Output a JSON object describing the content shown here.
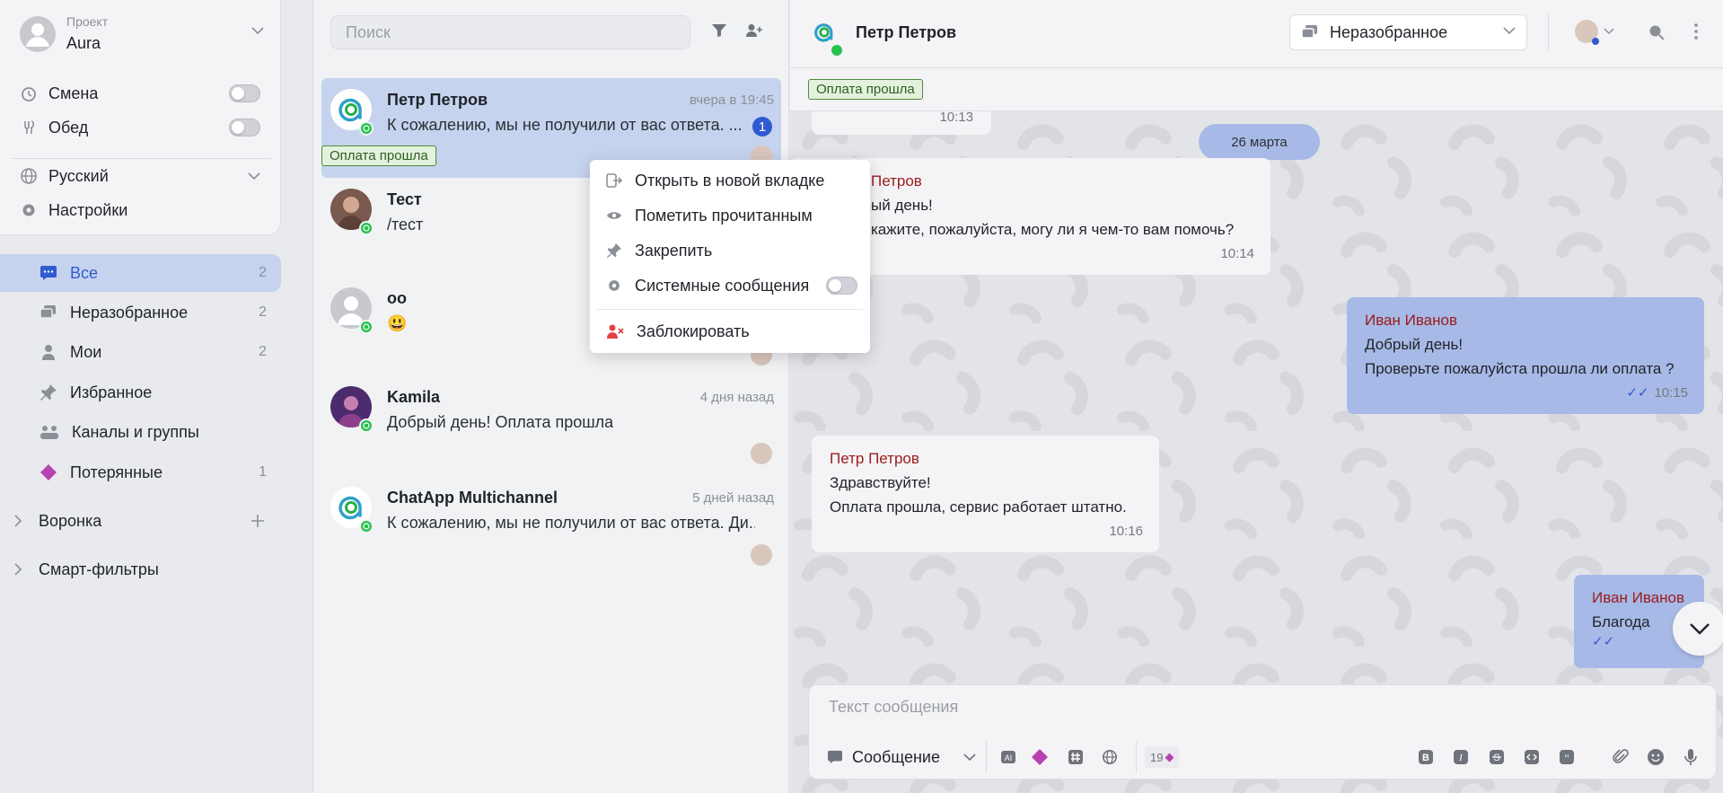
{
  "sidebar": {
    "project_label": "Проект",
    "project_name": "Aura",
    "shift_label": "Смена",
    "lunch_label": "Обед",
    "language": "Русский",
    "settings_label": "Настройки",
    "nav": [
      {
        "label": "Все",
        "count": "2",
        "icon": "chat-bubble-icon",
        "active": true
      },
      {
        "label": "Неразобранное",
        "count": "2",
        "icon": "inbox-stack-icon"
      },
      {
        "label": "Мои",
        "count": "2",
        "icon": "user-icon"
      },
      {
        "label": "Избранное",
        "count": "",
        "icon": "pin-icon"
      },
      {
        "label": "Каналы и группы",
        "count": "",
        "icon": "group-icon"
      },
      {
        "label": "Потерянные",
        "count": "1",
        "icon": "diamond-icon"
      }
    ],
    "groups": [
      {
        "label": "Воронка"
      },
      {
        "label": "Смарт-фильтры"
      }
    ]
  },
  "list": {
    "search_placeholder": "Поиск",
    "chats": [
      {
        "name": "Петр Петров",
        "time": "вчера в 19:45",
        "message": "К сожалению, мы не получили от вас ответа. ...",
        "unread": "1",
        "tag": "Оплата прошла"
      },
      {
        "name": "Тест",
        "time": "",
        "message": "/тест"
      },
      {
        "name": "оо",
        "time": "",
        "message": "😃"
      },
      {
        "name": "Kamila",
        "time": "4 дня назад",
        "message": "Добрый день! Оплата прошла"
      },
      {
        "name": "ChatApp Multichannel",
        "time": "5 дней назад",
        "message": "К сожалению, мы не получили от вас ответа. Ди..."
      }
    ]
  },
  "menu": {
    "open_new_tab": "Открыть в новой вкладке",
    "mark_read": "Пометить прочитанным",
    "pin": "Закрепить",
    "system_messages": "Системные сообщения",
    "block": "Заблокировать"
  },
  "conversation": {
    "contact_name": "Петр Петров",
    "status_dropdown": "Неразобранное",
    "tag": "Оплата прошла",
    "date_divider": "26 марта",
    "prev_time": "10:13",
    "messages": [
      {
        "from": "Петров",
        "line1": "ый день!",
        "line2": "кажите, пожалуйста, могу ли я чем-то вам помочь?",
        "time": "10:14"
      },
      {
        "from": "Иван Иванов",
        "line1": "Добрый день!",
        "line2": "Проверьте пожалуйста прошла ли оплата ?",
        "time": "10:15"
      },
      {
        "from": "Петр Петров",
        "line1": "Здравствуйте!",
        "line2": "Оплата прошла, сервис работает штатно.",
        "time": "10:16"
      },
      {
        "from": "Иван Иванов",
        "line1": "Благода",
        "line2": "",
        "time": ""
      }
    ],
    "composer_placeholder": "Текст сообщения",
    "message_type": "Сообщение",
    "char_counter": "19"
  },
  "colors": {
    "accent": "#2f5bd0",
    "active_bg": "#c6d3ee",
    "own_bubble": "#a7b9e6",
    "tag_bg": "#e4f2dd",
    "danger": "#e14343",
    "whatsapp": "#27c14f"
  }
}
